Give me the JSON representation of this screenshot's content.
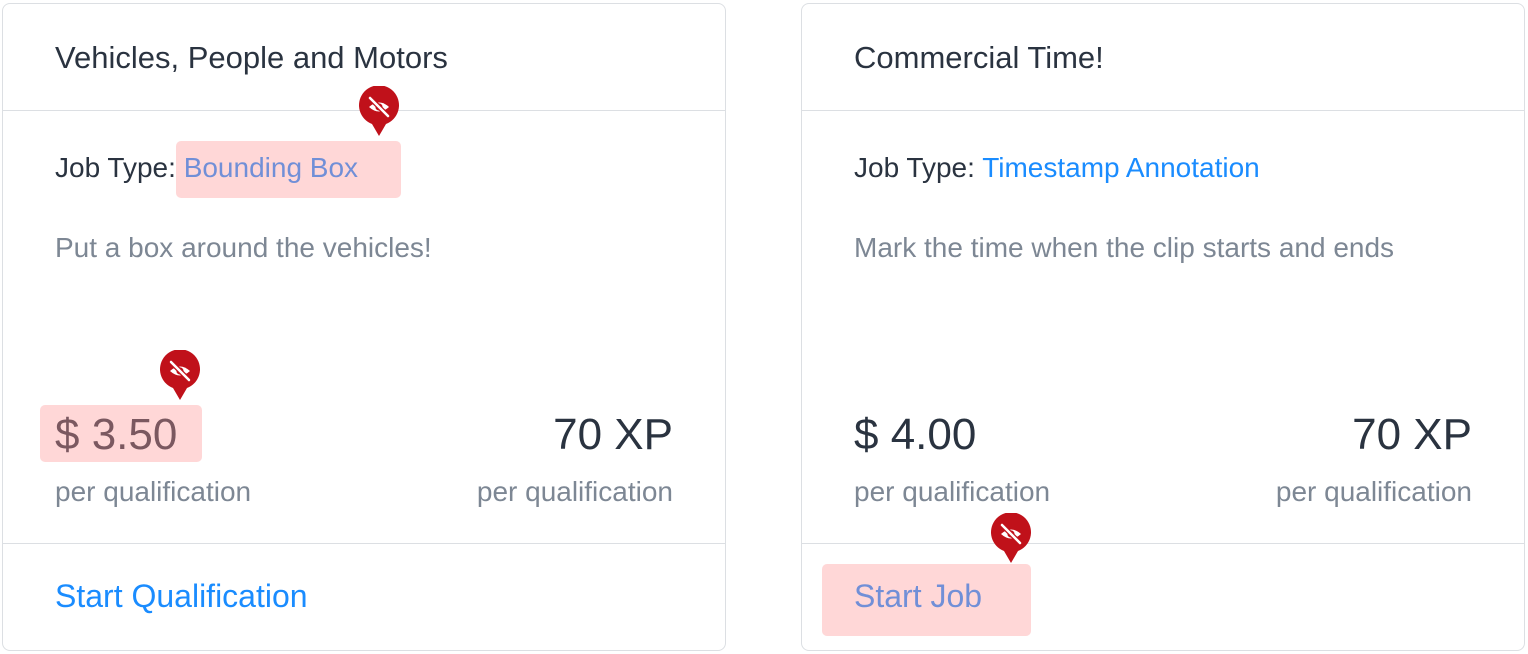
{
  "cards": [
    {
      "title": "Vehicles, People and Motors",
      "job_type_label": "Job Type:",
      "job_type_value": "Bounding Box",
      "description": "Put a box around the vehicles!",
      "price": "$ 3.50",
      "price_unit": "per qualification",
      "xp": "70 XP",
      "xp_unit": "per qualification",
      "action": "Start Qualification"
    },
    {
      "title": "Commercial Time!",
      "job_type_label": "Job Type:",
      "job_type_value": "Timestamp Annotation",
      "description": "Mark the time when the clip starts and ends",
      "price": "$ 4.00",
      "price_unit": "per qualification",
      "xp": "70 XP",
      "xp_unit": "per qualification",
      "action": "Start Job"
    }
  ],
  "annotation_markers": {
    "icon": "hidden-eye-icon",
    "color": "#c0111a",
    "highlight_color": "#ffd4d4"
  },
  "colors": {
    "link": "#1a8cff",
    "text_primary": "#2a3340",
    "text_secondary": "#7d8794",
    "border": "#dcdfe3"
  }
}
